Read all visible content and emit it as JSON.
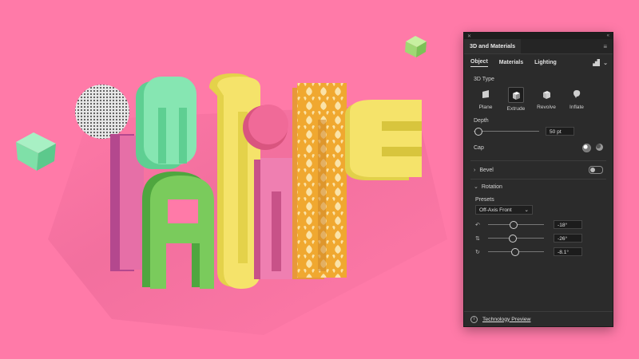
{
  "panel": {
    "title": "3D and Materials",
    "menu_icon": "menu-icon",
    "tabs": [
      {
        "label": "Object",
        "active": true
      },
      {
        "label": "Materials",
        "active": false
      },
      {
        "label": "Lighting",
        "active": false
      }
    ],
    "type_section": {
      "label": "3D Type",
      "types": [
        {
          "label": "Plane",
          "icon": "plane-icon",
          "selected": false
        },
        {
          "label": "Extrude",
          "icon": "extrude-icon",
          "selected": true
        },
        {
          "label": "Revolve",
          "icon": "revolve-icon",
          "selected": false
        },
        {
          "label": "Inflate",
          "icon": "inflate-icon",
          "selected": false
        }
      ]
    },
    "depth": {
      "label": "Depth",
      "value": "50 pt",
      "level": 0.0
    },
    "cap": {
      "label": "Cap"
    },
    "bevel": {
      "label": "Bevel",
      "enabled": false
    },
    "rotation": {
      "label": "Rotation",
      "presets_label": "Presets",
      "preset_value": "Off-Axis Front",
      "x": {
        "value": "-18°",
        "level": 0.45
      },
      "y": {
        "value": "-26°",
        "level": 0.43
      },
      "z": {
        "value": "-8.1°",
        "level": 0.47
      }
    },
    "footer": {
      "link": "Technology Preview"
    }
  },
  "artwork": {
    "background_color": "#ff7aa8",
    "description_colors": [
      "#7fe0a8",
      "#f5e36a",
      "#e86fa0",
      "#6fbf5a",
      "#f2b233",
      "#c04a9a"
    ]
  }
}
